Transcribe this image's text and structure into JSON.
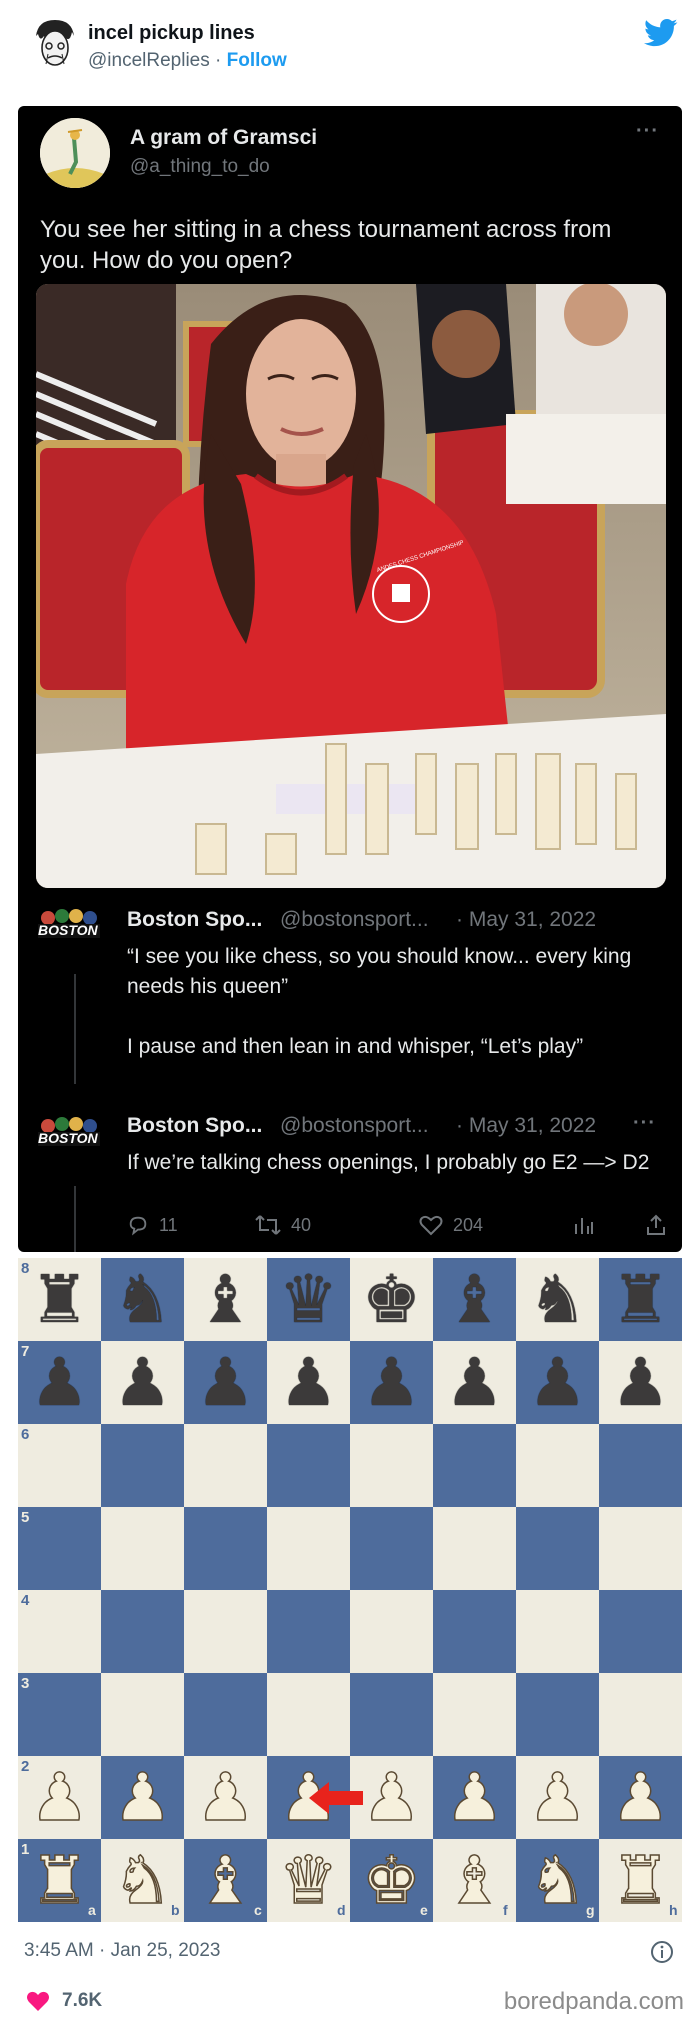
{
  "outer_tweet": {
    "name": "incel pickup lines",
    "handle": "@incelReplies",
    "separator": "·",
    "follow_label": "Follow",
    "timestamp": "3:45 AM · Jan 25, 2023",
    "likes": "7.6K"
  },
  "quoted_tweet": {
    "name": "A gram of Gramsci",
    "handle": "@a_thing_to_do",
    "text": "You see her sitting in a chess tournament across from you. How do you open?",
    "photo_sweater_text": "ANDES CHESS CHAMPIONSHIP"
  },
  "replies": [
    {
      "name": "Boston Spo...",
      "handle": "@bostonsport...",
      "date": "· May 31, 2022",
      "avatar_text": "BOSTON",
      "lines": [
        "“I see you like chess, so you should know... every king needs his queen”",
        "",
        "I pause and then lean in and whisper, “Let’s play”"
      ]
    },
    {
      "name": "Boston Spo...",
      "handle": "@bostonsport...",
      "date": "· May 31, 2022",
      "avatar_text": "BOSTON",
      "lines": [
        "If we’re talking chess openings, I probably go E2 —> D2"
      ]
    }
  ],
  "actions": {
    "replies": "11",
    "retweets": "40",
    "likes": "204"
  },
  "board": {
    "ranks": [
      "8",
      "7",
      "6",
      "5",
      "4",
      "3",
      "2",
      "1"
    ],
    "files": [
      "a",
      "b",
      "c",
      "d",
      "e",
      "f",
      "g",
      "h"
    ],
    "light_color": "#efece0",
    "dark_color": "#4e6c9c",
    "arrow_color": "#e8231c"
  },
  "watermark": "boredpanda.com",
  "colors": {
    "brand_blue": "#1d9bf0",
    "like_pink": "#f91880"
  }
}
